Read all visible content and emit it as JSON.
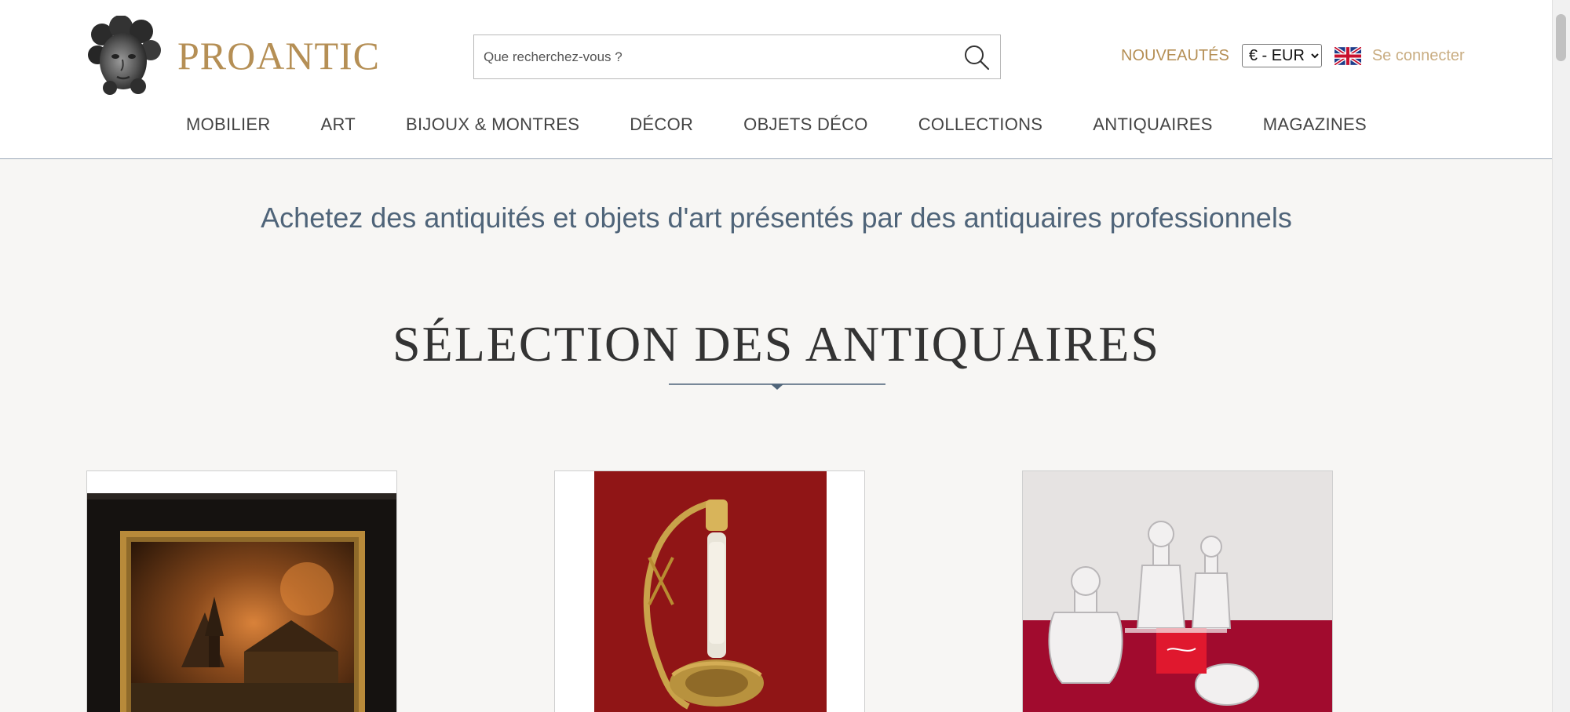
{
  "brand": {
    "name": "PROANTIC"
  },
  "search": {
    "placeholder": "Que recherchez-vous ?"
  },
  "header": {
    "news_label": "NOUVEAUTÉS",
    "currency": {
      "selected": "€ - EUR",
      "options": [
        "€ - EUR"
      ]
    },
    "login_label": "Se connecter"
  },
  "nav": {
    "items": [
      {
        "label": "MOBILIER"
      },
      {
        "label": "ART"
      },
      {
        "label": "BIJOUX & MONTRES"
      },
      {
        "label": "DÉCOR"
      },
      {
        "label": "OBJETS DÉCO"
      },
      {
        "label": "COLLECTIONS"
      },
      {
        "label": "ANTIQUAIRES"
      },
      {
        "label": "MAGAZINES"
      }
    ]
  },
  "main": {
    "tagline": "Achetez des antiquités et objets d'art présentés par des antiquaires professionnels",
    "section_title": "SÉLECTION DES ANTIQUAIRES",
    "cards": [
      {
        "image": "painting-village-fire"
      },
      {
        "image": "antique-sword-hilt"
      },
      {
        "image": "crystal-perfume-bottles"
      }
    ]
  },
  "colors": {
    "gold": "#b58f55",
    "light_gold": "#c9ad82",
    "slate_blue": "#4f6479",
    "background": "#f7f6f4"
  },
  "icons": {
    "search": "search-icon",
    "flag": "uk-flag-icon",
    "logo": "cherub-head-logo"
  }
}
